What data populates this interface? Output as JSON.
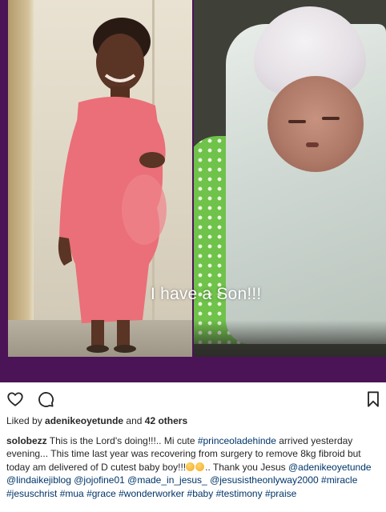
{
  "post": {
    "image_caption": "I have a Son!!!"
  },
  "likes": {
    "prefix": "Liked by",
    "user": "adenikeoyetunde",
    "conjunction": "and",
    "others": "42 others"
  },
  "caption": {
    "username": "solobezz",
    "text_1": " This is the Lord's doing!!!.. Mi cute ",
    "tag_1": "#princeoladehinde",
    "text_2": " arrived yesterday evening... This time last year was recovering from surgery to remove 8kg fibroid but today am delivered of D cutest baby boy!!!",
    "text_3": ".. Thank you Jesus ",
    "mentions": [
      "@adenikeoyetunde",
      "@lindaikejiblog",
      "@jojofine01",
      "@made_in_jesus_",
      "@jesusistheonlyway2000"
    ],
    "hashtags": [
      "#miracle",
      "#jesuschrist",
      "#mua",
      "#grace",
      "#wonderworker",
      "#baby",
      "#testimony",
      "#praise"
    ]
  },
  "icons": {
    "like": "heart-outline-icon",
    "comment": "comment-bubble-icon",
    "save": "bookmark-icon",
    "emoji": "smiling-face-emoji"
  },
  "colors": {
    "link": "#003569",
    "text": "#262626",
    "background_frame": "#4a1457"
  }
}
